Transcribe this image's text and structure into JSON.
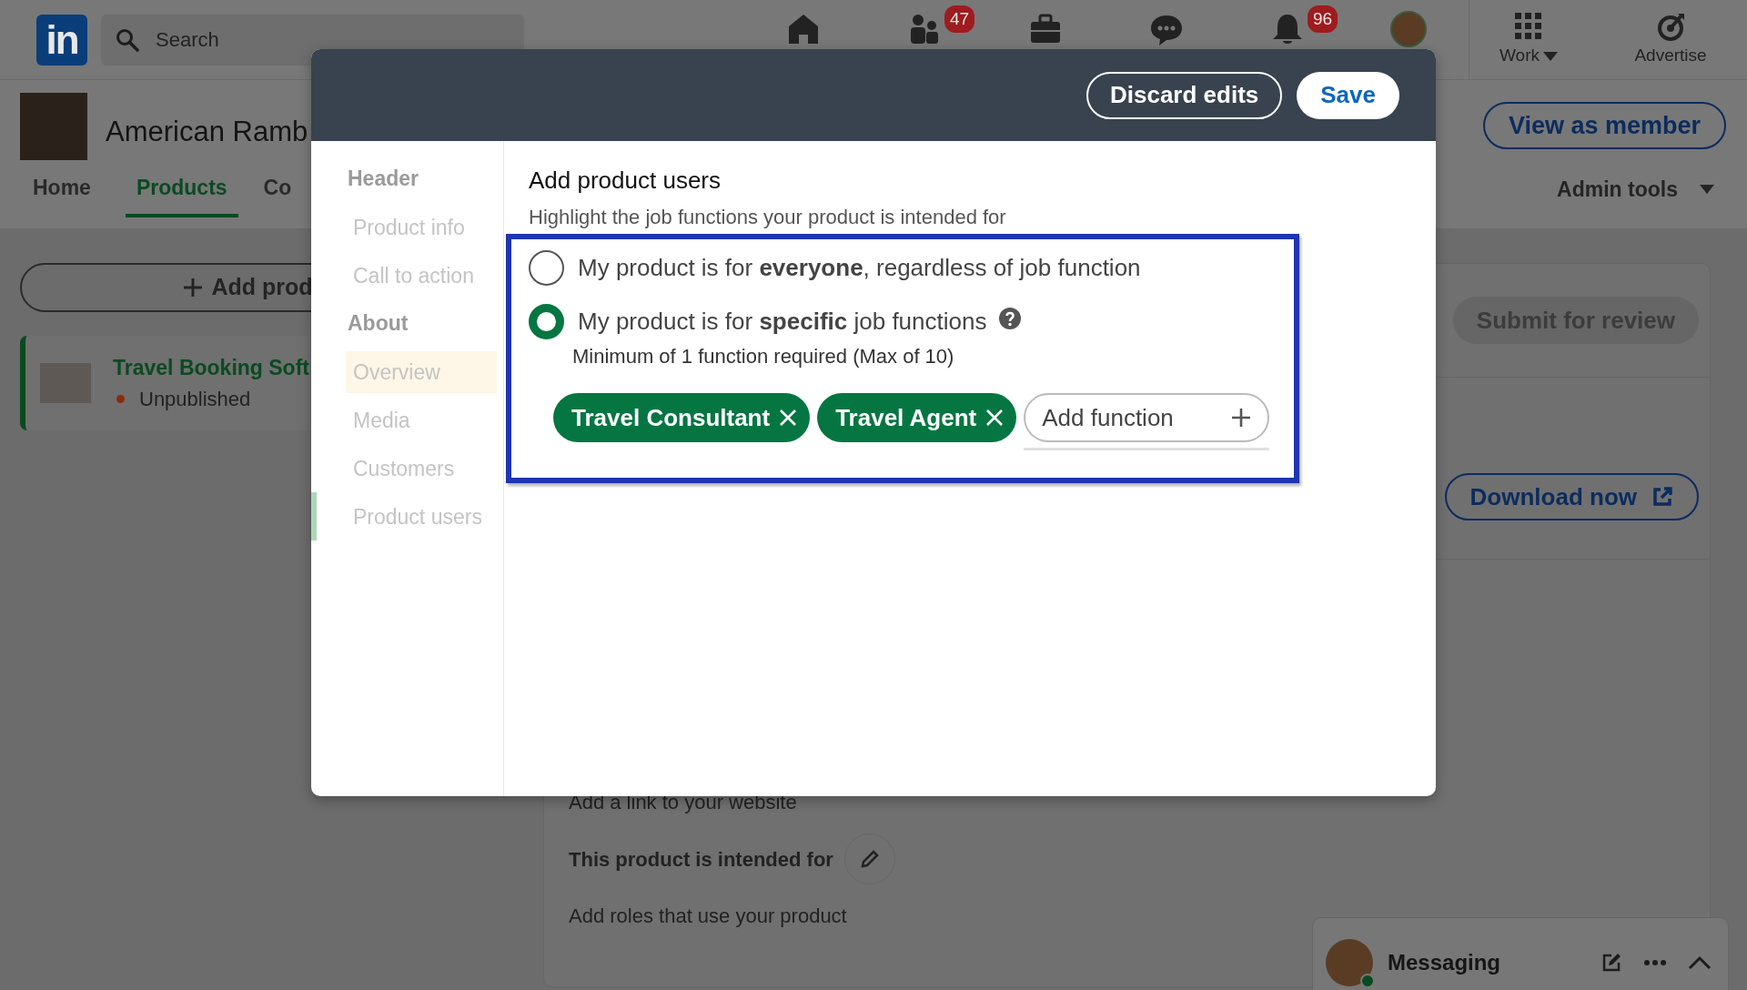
{
  "top_nav": {
    "logo_text": "in",
    "search": {
      "placeholder": "Search"
    },
    "items": [
      {
        "kind": "home"
      },
      {
        "kind": "network",
        "badge": "47"
      },
      {
        "kind": "jobs"
      },
      {
        "kind": "chat"
      },
      {
        "kind": "bell",
        "badge": "96"
      },
      {
        "kind": "avatar"
      }
    ],
    "work": "Work",
    "advertise": "Advertise"
  },
  "page_header": {
    "title": "American Ramb",
    "view_as_member": "View as member",
    "tabs": [
      {
        "label": "Home",
        "selected": false
      },
      {
        "label": "Products",
        "selected": true
      },
      {
        "label": "Co",
        "selected": false
      }
    ],
    "admin_tools": "Admin tools"
  },
  "left_panel": {
    "add_button": "Add prod",
    "products": [
      {
        "name": "Travel Booking Soft",
        "status": "Unpublished",
        "selected": true
      }
    ]
  },
  "right_panel": {
    "submit_button": {
      "label": "Submit for review",
      "disabled": true
    },
    "download_button": "Download now"
  },
  "background_form": [
    {
      "kind": "text",
      "text": "Add a link to your website"
    },
    {
      "kind": "heading",
      "text": "This product is intended for"
    },
    {
      "kind": "text",
      "text": "Add roles that use your product"
    }
  ],
  "modal": {
    "buttons": [
      {
        "label": "Discard edits",
        "kind": "secondary"
      },
      {
        "label": "Save",
        "kind": "primary"
      }
    ],
    "sidebar": [
      {
        "kind": "section",
        "label": "Header"
      },
      {
        "kind": "item",
        "label": "Product info",
        "selected": false,
        "highlighted": false
      },
      {
        "kind": "item",
        "label": "Call to action",
        "selected": false,
        "highlighted": false
      },
      {
        "kind": "section",
        "label": "About"
      },
      {
        "kind": "item",
        "label": "Overview",
        "selected": false,
        "highlighted": true
      },
      {
        "kind": "item",
        "label": "Media",
        "selected": false,
        "highlighted": false
      },
      {
        "kind": "item",
        "label": "Customers",
        "selected": false,
        "highlighted": false
      },
      {
        "kind": "item",
        "label": "Product users",
        "selected": true,
        "highlighted": false
      }
    ],
    "title": "Add product users",
    "subtitle": "Highlight the job functions your product is intended for",
    "options": [
      {
        "label": "My product is for **everyone**, regardless of job function",
        "selected": false
      },
      {
        "label": "My product is for **specific** job functions",
        "selected": true,
        "help": true,
        "note": "Minimum of 1 function required (Max of 10)"
      }
    ],
    "functions": [
      "Travel Consultant",
      "Travel Agent"
    ],
    "add_function": "Add function"
  },
  "messaging": {
    "title": "Messaging"
  }
}
